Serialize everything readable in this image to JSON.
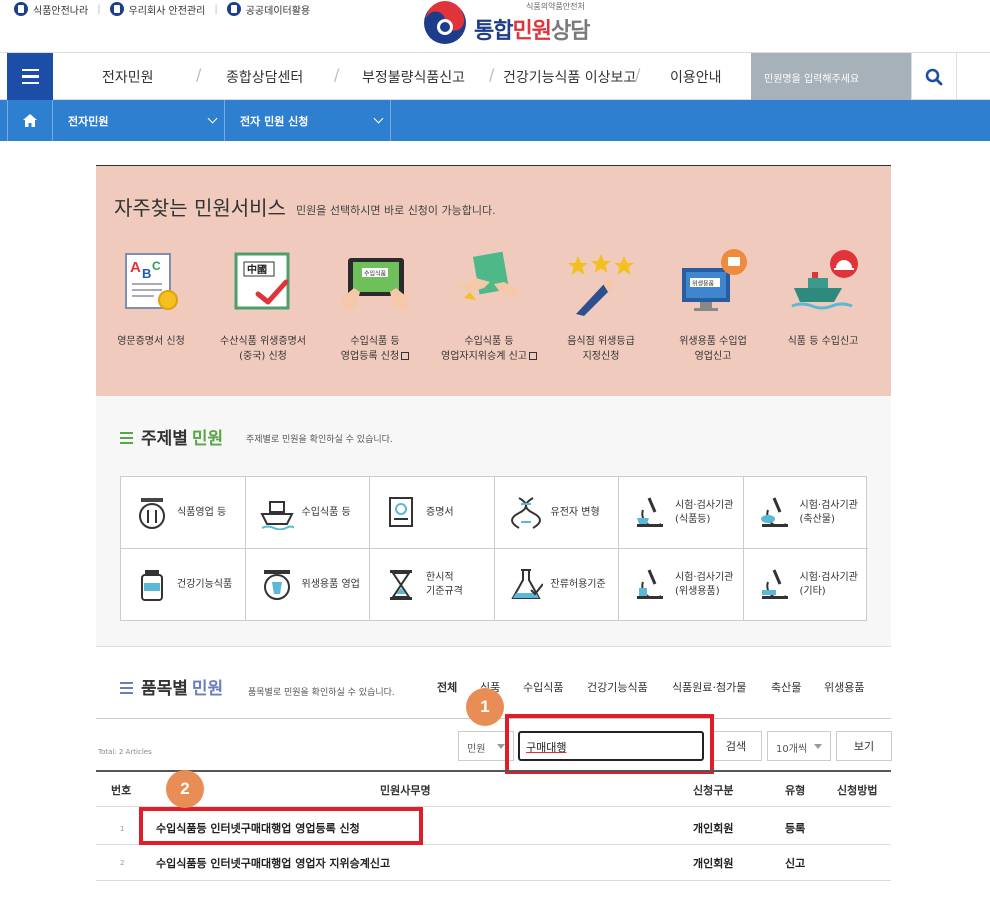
{
  "utility": {
    "links": [
      "식품안전나라",
      "우리회사 안전관리",
      "공공데이터활용"
    ]
  },
  "logo": {
    "agency": "식품의약품안전처",
    "part1": "통합",
    "part2": "민원",
    "part3": "상담"
  },
  "nav": {
    "items": [
      "전자민원",
      "종합상담센터",
      "부정불량식품신고",
      "건강기능식품 이상보고",
      "이용안내"
    ],
    "search_placeholder": "민원명을 입력해주세요"
  },
  "location": {
    "level1": "전자민원",
    "level2": "전자 민원 신청"
  },
  "frequent": {
    "title": "자주찾는 민원서비스",
    "desc": "민원을 선택하시면 바로 신청이 가능합니다.",
    "services": [
      {
        "l1": "영문증명서 신청",
        "l2": "",
        "ext": false,
        "icon": "certificate-abc-icon"
      },
      {
        "l1": "수산식품 위생증명서",
        "l2": "(중국) 신청",
        "ext": false,
        "icon": "china-certificate-icon"
      },
      {
        "l1": "수입식품 등",
        "l2": "영업등록 신청",
        "ext": true,
        "icon": "tablet-import-icon"
      },
      {
        "l1": "수입식품 등",
        "l2": "영업자지위승계 신고",
        "ext": true,
        "icon": "handover-icon"
      },
      {
        "l1": "음식점 위생등급",
        "l2": "지정신청",
        "ext": false,
        "icon": "stars-rating-icon"
      },
      {
        "l1": "위생용품 수입업",
        "l2": "영업신고",
        "ext": false,
        "icon": "hygiene-monitor-icon"
      },
      {
        "l1": "식품 등 수입신고",
        "l2": "",
        "ext": false,
        "icon": "ship-import-icon"
      }
    ]
  },
  "topics": {
    "title_a": "주제별",
    "title_b": "민원",
    "desc": "주제별로 민원을 확인하실 수 있습니다.",
    "cells": [
      {
        "l1": "식품영업 등",
        "l2": "",
        "icon": "dining-icon"
      },
      {
        "l1": "수입식품 등",
        "l2": "",
        "icon": "ship-icon"
      },
      {
        "l1": "증명서",
        "l2": "",
        "icon": "certificate-icon"
      },
      {
        "l1": "유전자 변형",
        "l2": "",
        "icon": "dna-icon"
      },
      {
        "l1": "시험·검사기관",
        "l2": "(식품등)",
        "icon": "microscope-food-icon"
      },
      {
        "l1": "시험·검사기관",
        "l2": "(축산물)",
        "icon": "microscope-meat-icon"
      },
      {
        "l1": "건강기능식품",
        "l2": "",
        "icon": "supplement-jar-icon"
      },
      {
        "l1": "위생용품 영업",
        "l2": "",
        "icon": "cup-icon"
      },
      {
        "l1": "한시적",
        "l2": "기준규격",
        "icon": "hourglass-icon"
      },
      {
        "l1": "잔류허용기준",
        "l2": "",
        "icon": "flask-check-icon"
      },
      {
        "l1": "시험·검사기관",
        "l2": "(위생용품)",
        "icon": "microscope-hygiene-icon"
      },
      {
        "l1": "시험·검사기관",
        "l2": "(기타)",
        "icon": "microscope-etc-icon"
      }
    ]
  },
  "items": {
    "title_a": "품목별",
    "title_b": "민원",
    "desc": "품목별로 민원을 확인하실 수 있습니다.",
    "categories": [
      "전체",
      "식품",
      "수입식품",
      "건강기능식품",
      "식품원료·첨가물",
      "축산물",
      "위생용품"
    ]
  },
  "search": {
    "total": "Total: 2 Articles",
    "scope": "민원",
    "keyword": "구매대행",
    "search_label": "검색",
    "page_size": "10개씩",
    "view_label": "보기"
  },
  "annotations": {
    "badge1": "1",
    "badge2": "2"
  },
  "table": {
    "headers": [
      "번호",
      "민원사무명",
      "신청구분",
      "유형",
      "신청방법"
    ],
    "rows": [
      {
        "no": "1",
        "name": "수입식품등 인터넷구매대행업 영업등록 신청",
        "applicant": "개인회원",
        "type": "등록",
        "method": ""
      },
      {
        "no": "2",
        "name": "수입식품등 인터넷구매대행업 영업자 지위승계신고",
        "applicant": "개인회원",
        "type": "신고",
        "method": ""
      }
    ]
  },
  "colors": {
    "brand_blue": "#1c4ea8",
    "location_blue": "#2e7fd0",
    "frequent_bg": "#f0cbbd",
    "highlight_red": "#e01e2a",
    "badge_orange": "#e88d55"
  }
}
